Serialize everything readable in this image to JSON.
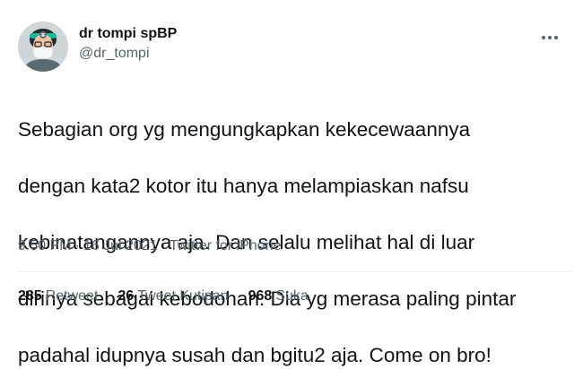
{
  "author": {
    "display_name": "dr tompi spBP",
    "handle": "@dr_tompi",
    "avatar_icon": "profile-photo"
  },
  "tweet": {
    "text_lines": [
      "Sebagian org yg mengungkapkan kekecewaannya",
      "dengan kata2 kotor itu hanya melampiaskan nafsu",
      "kebinatangannya aja. Dan selalu melihat hal di luar",
      "dirinya sebagai kebodohan. Dia yg merasa paling pintar",
      "padahal idupnya susah dan bgitu2 aja. Come on bro!"
    ],
    "time": "9.50 PM",
    "date": "16 Jul 2021",
    "source": "Twitter for iPhone",
    "separator": "·"
  },
  "stats": {
    "retweets": {
      "count": "285",
      "label": "Retweet"
    },
    "quotes": {
      "count": "26",
      "label": "Tweet Kutipan"
    },
    "likes": {
      "count": "968",
      "label": "Suka"
    }
  },
  "icons": {
    "more": "more-horizontal-icon"
  },
  "colors": {
    "text": "#0f1419",
    "secondary": "#536471",
    "divider": "#eff3f4"
  }
}
